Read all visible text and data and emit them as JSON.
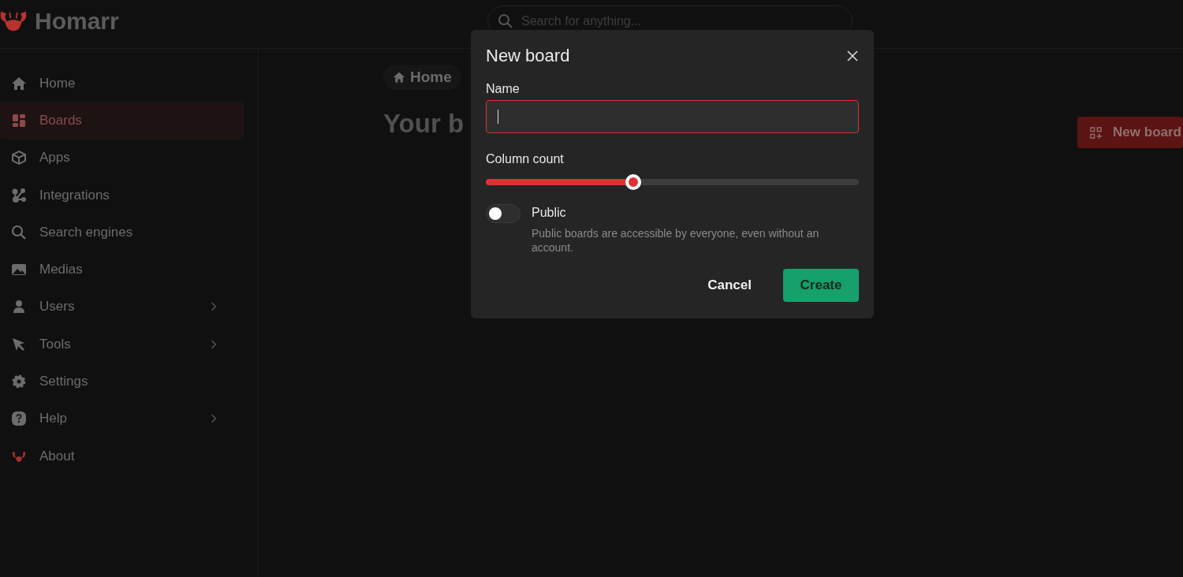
{
  "header": {
    "brand": "Homarr",
    "search": {
      "placeholder": "Search for anything..."
    }
  },
  "sidebar": {
    "items": [
      {
        "label": "Home",
        "selected": false,
        "has_submenu": false
      },
      {
        "label": "Boards",
        "selected": true,
        "has_submenu": false
      },
      {
        "label": "Apps",
        "selected": false,
        "has_submenu": false
      },
      {
        "label": "Integrations",
        "selected": false,
        "has_submenu": false
      },
      {
        "label": "Search engines",
        "selected": false,
        "has_submenu": false
      },
      {
        "label": "Medias",
        "selected": false,
        "has_submenu": false
      },
      {
        "label": "Users",
        "selected": false,
        "has_submenu": true
      },
      {
        "label": "Tools",
        "selected": false,
        "has_submenu": true
      },
      {
        "label": "Settings",
        "selected": false,
        "has_submenu": false
      },
      {
        "label": "Help",
        "selected": false,
        "has_submenu": true
      },
      {
        "label": "About",
        "selected": false,
        "has_submenu": false
      }
    ]
  },
  "main": {
    "breadcrumb": "Home",
    "heading": "Your b",
    "new_board_button": "New board"
  },
  "dialog": {
    "title": "New board",
    "name_label": "Name",
    "name_error": true,
    "column_count_label": "Column count",
    "column_count": {
      "level": 0.395
    },
    "public": {
      "label": "Public",
      "on": false,
      "description": "Public boards are accessible by everyone, even without an account."
    },
    "buttons": {
      "cancel": "Cancel",
      "create": "Create"
    }
  }
}
